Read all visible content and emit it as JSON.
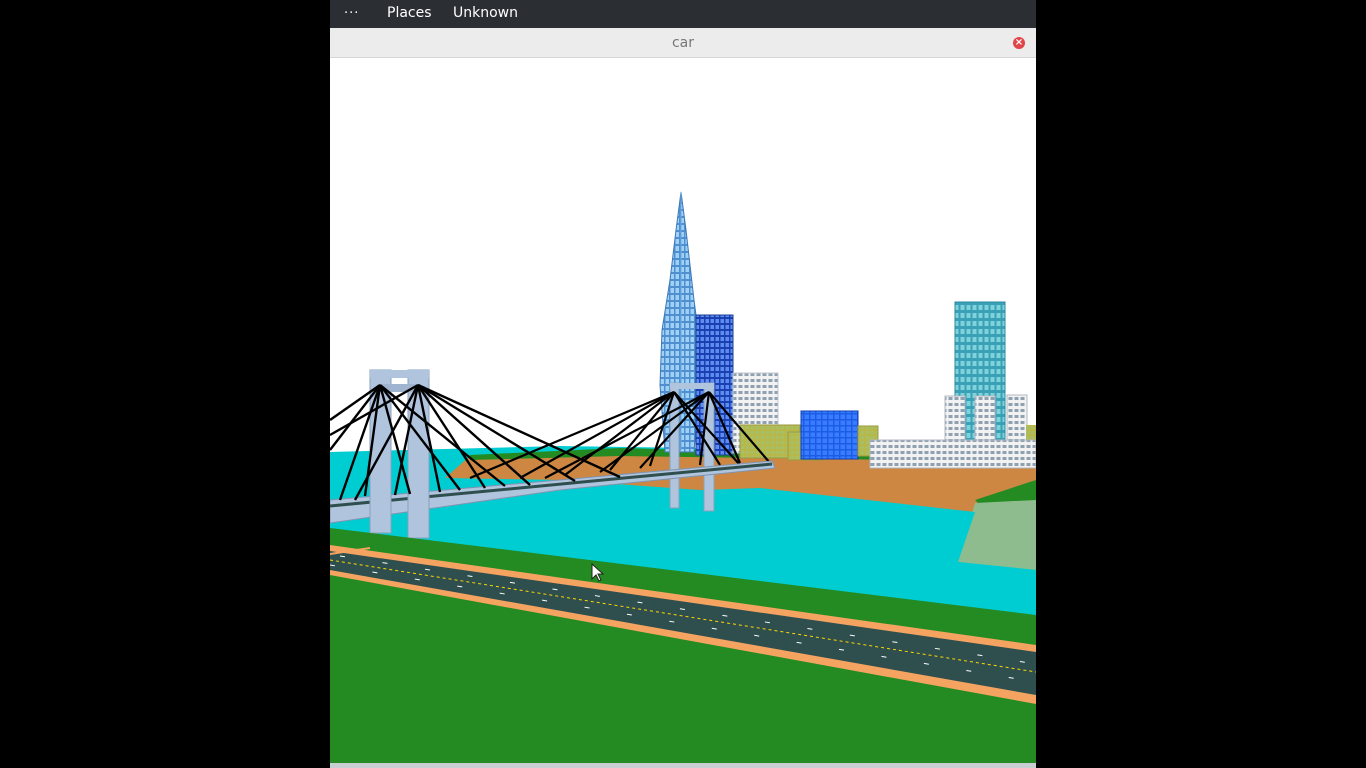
{
  "topbar": {
    "dots_label": "···",
    "places_label": "Places",
    "unknown_label": "Unknown"
  },
  "window": {
    "title": "car",
    "close_icon": "close-icon"
  },
  "scene": {
    "sky_color": "#ffffff",
    "water_color": "#00cdd1",
    "grass_color": "#238b22",
    "sand_color": "#cd8742",
    "road_color": "#2f4f4f",
    "road_edge_color": "#f4a460",
    "bridge_color": "#b0c4de",
    "cable_color": "#000000"
  }
}
